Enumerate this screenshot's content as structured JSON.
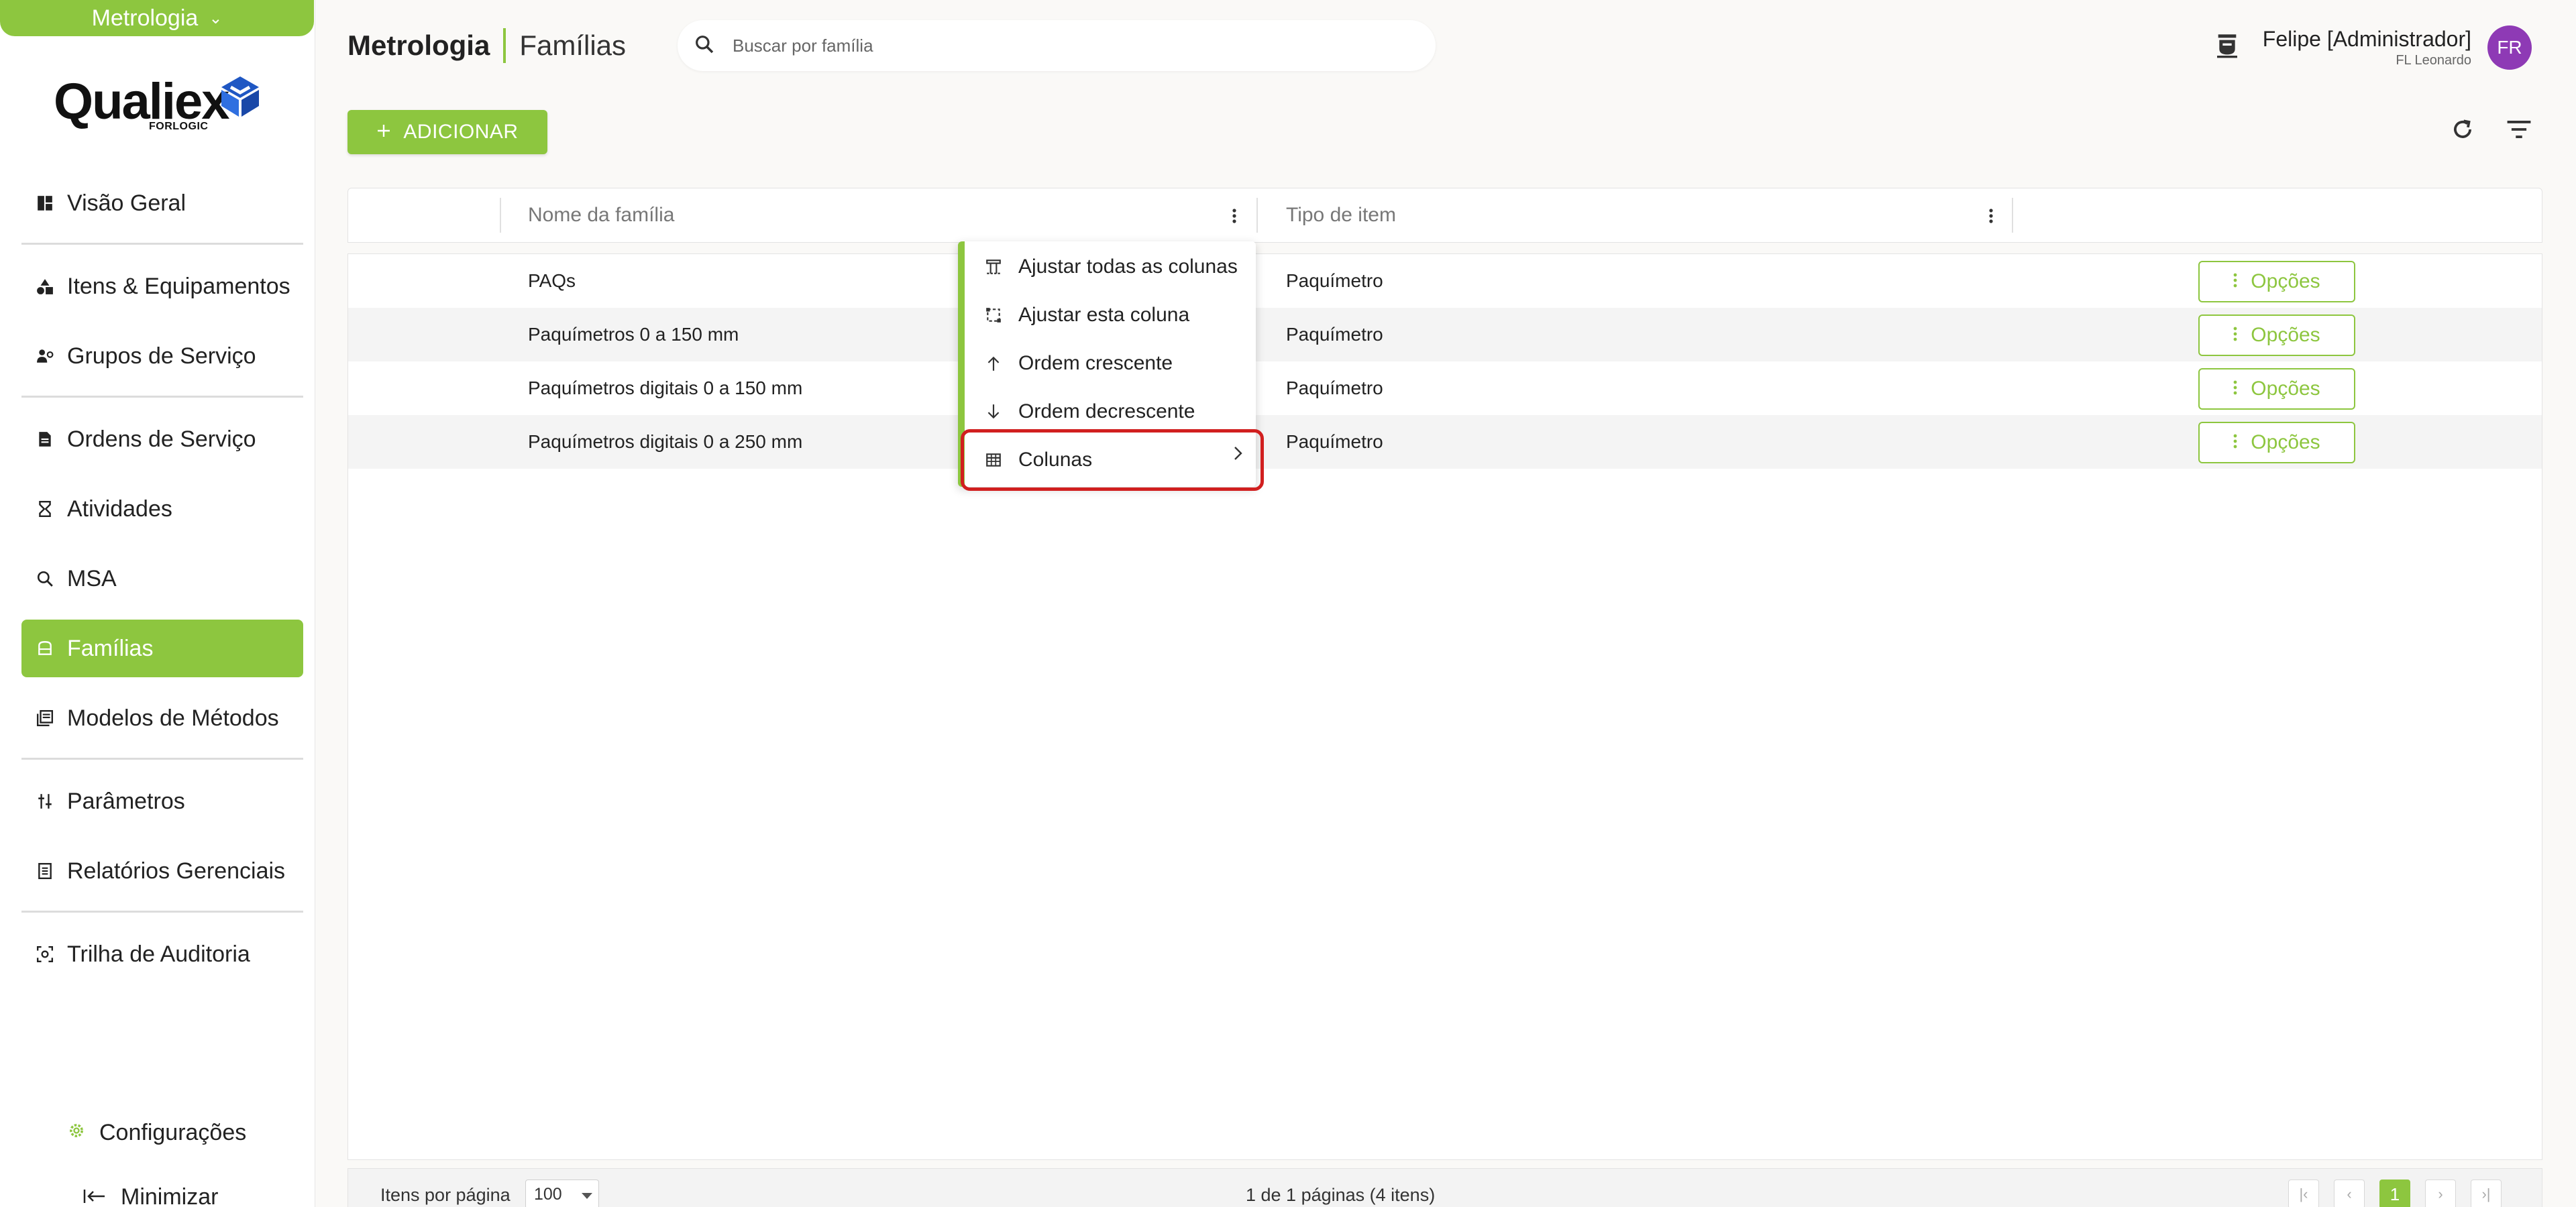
{
  "module_switch": {
    "label": "Metrologia",
    "icon": "chevron-down-icon"
  },
  "logo": {
    "brand": "Qualiex",
    "maker": "FORLOGIC"
  },
  "sidebar": {
    "items": [
      {
        "label": "Visão Geral",
        "icon": "dashboard-icon"
      },
      {
        "label": "Itens & Equipamentos",
        "icon": "shapes-icon"
      },
      {
        "label": "Grupos de Serviço",
        "icon": "people-gear-icon"
      },
      {
        "label": "Ordens de Serviço",
        "icon": "document-icon"
      },
      {
        "label": "Atividades",
        "icon": "hourglass-icon"
      },
      {
        "label": "MSA",
        "icon": "magnifier-analysis-icon"
      },
      {
        "label": "Famílias",
        "icon": "family-icon",
        "active": true
      },
      {
        "label": "Modelos de Métodos",
        "icon": "library-icon"
      },
      {
        "label": "Parâmetros",
        "icon": "sliders-icon"
      },
      {
        "label": "Relatórios Gerenciais",
        "icon": "report-icon"
      },
      {
        "label": "Trilha de Auditoria",
        "icon": "audit-icon"
      }
    ],
    "settings": "Configurações",
    "minimize": "Minimizar"
  },
  "header": {
    "module": "Metrologia",
    "section": "Famílias",
    "search_placeholder": "Buscar por família"
  },
  "user": {
    "name": "Felipe [Administrador]",
    "org": "FL Leonardo",
    "initials": "FR"
  },
  "toolbar": {
    "add_label": "ADICIONAR"
  },
  "table": {
    "columns": [
      "Nome da família",
      "Tipo de item"
    ],
    "rows": [
      {
        "name": "PAQs",
        "type": "Paquímetro",
        "options": "Opções"
      },
      {
        "name": "Paquímetros 0 a 150 mm",
        "type": "Paquímetro",
        "options": "Opções"
      },
      {
        "name": "Paquímetros digitais 0 a 150 mm",
        "type": "Paquímetro",
        "options": "Opções"
      },
      {
        "name": "Paquímetros digitais 0 a 250 mm",
        "type": "Paquímetro",
        "options": "Opções"
      }
    ]
  },
  "context_menu": {
    "items": [
      {
        "label": "Ajustar todas as colunas",
        "icon": "autosize-all-icon"
      },
      {
        "label": "Ajustar esta coluna",
        "icon": "autosize-column-icon"
      },
      {
        "label": "Ordem crescente",
        "icon": "arrow-up-icon"
      },
      {
        "label": "Ordem decrescente",
        "icon": "arrow-down-icon"
      },
      {
        "label": "Colunas",
        "icon": "table-columns-icon",
        "highlighted": true
      }
    ]
  },
  "footer": {
    "items_per_page_label": "Itens por página",
    "items_per_page": "100",
    "page_info": "1 de 1 páginas (4 itens)",
    "current_page": "1"
  },
  "colors": {
    "accent": "#8dc63f",
    "avatar": "#8e3ab5",
    "highlight": "#d11f1f"
  }
}
